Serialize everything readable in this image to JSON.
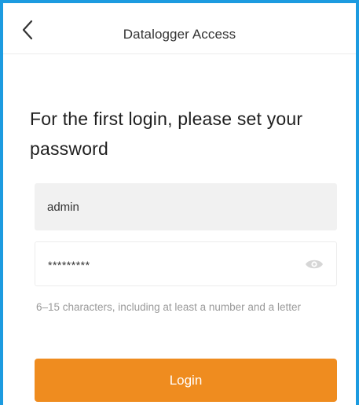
{
  "header": {
    "title": "Datalogger Access",
    "back_icon": "chevron-left-icon"
  },
  "main": {
    "heading": "For the first login, please set your password",
    "username_value": "admin",
    "password_value": "*********",
    "password_toggle_icon": "eye-icon",
    "hint": "6–15 characters, including at least a number and a letter",
    "login_label": "Login"
  },
  "colors": {
    "accent": "#ef8c1f",
    "frame_border": "#1c9be0",
    "input_background": "#f1f1f1",
    "hint_text": "#9a9a9a"
  }
}
